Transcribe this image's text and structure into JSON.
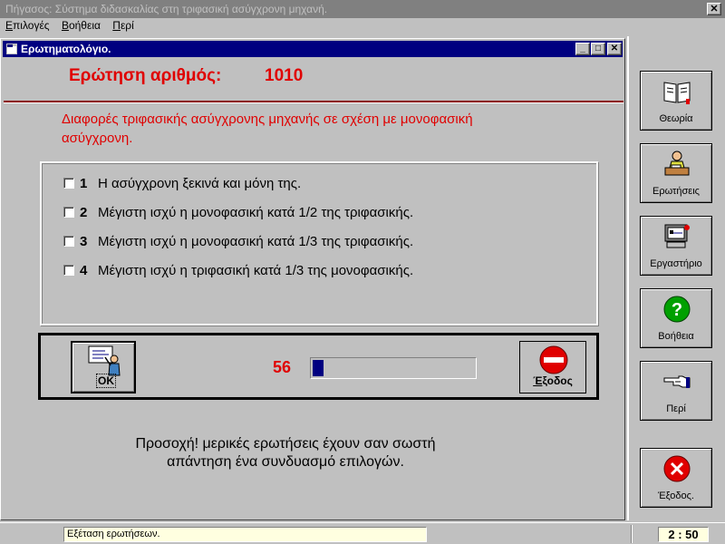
{
  "app": {
    "title": "Πήγασος: Σύστημα διδασκαλίας στη τριφασική ασύγχρονη μηχανή.",
    "close_symbol": "✕"
  },
  "menu": {
    "items": [
      {
        "label": "Επιλογές"
      },
      {
        "label": "Βοήθεια"
      },
      {
        "label": "Περί"
      }
    ]
  },
  "child_window": {
    "title": "Ερωτηματολόγιο.",
    "minimize_symbol": "_",
    "restore_symbol": "□",
    "close_symbol": "✕"
  },
  "question": {
    "label": "Ερώτηση αριθμός:",
    "number": "1010",
    "text": "Διαφορές τριφασικής ασύγχρονης μηχανής σε σχέση με μονοφασική ασύγχρονη.",
    "options": [
      {
        "num": "1",
        "text": "Η ασύγχρονη ξεκινά και μόνη της.",
        "checked": false
      },
      {
        "num": "2",
        "text": "Μέγιστη ισχύ η μονοφασική κατά 1/2 της τριφασικής.",
        "checked": false
      },
      {
        "num": "3",
        "text": "Μέγιστη ισχύ η μονοφασική κατά 1/3 της τριφασικής.",
        "checked": false
      },
      {
        "num": "4",
        "text": "Μέγιστη ισχύ η τριφασική κατά 1/3 της μονοφασικής.",
        "checked": false
      }
    ]
  },
  "actions": {
    "ok_label": "OK",
    "timer_value": "56",
    "progress_fraction": 0.07,
    "exit_label": "Έξοδος"
  },
  "notice": {
    "line1": "Προσοχή! μερικές ερωτήσεις έχουν σαν σωστή",
    "line2": "απάντηση ένα συνδυασμό επιλογών."
  },
  "toolbar": {
    "items": [
      {
        "label": "Θεωρία",
        "icon": "book-icon"
      },
      {
        "label": "Ερωτήσεις",
        "icon": "teacher-desk-icon"
      },
      {
        "label": "Εργαστήριο",
        "icon": "computer-lab-icon"
      },
      {
        "label": "Βοήθεια",
        "icon": "question-icon"
      },
      {
        "label": "Περί",
        "icon": "pointing-hand-icon"
      },
      {
        "label": "Έξοδος.",
        "icon": "close-circle-icon"
      }
    ]
  },
  "status": {
    "text": "Εξέταση ερωτήσεων.",
    "time": "2 : 50"
  },
  "colors": {
    "accent_red": "#e00000",
    "title_active": "#000080",
    "title_inactive": "#808080",
    "face": "#c0c0c0"
  }
}
